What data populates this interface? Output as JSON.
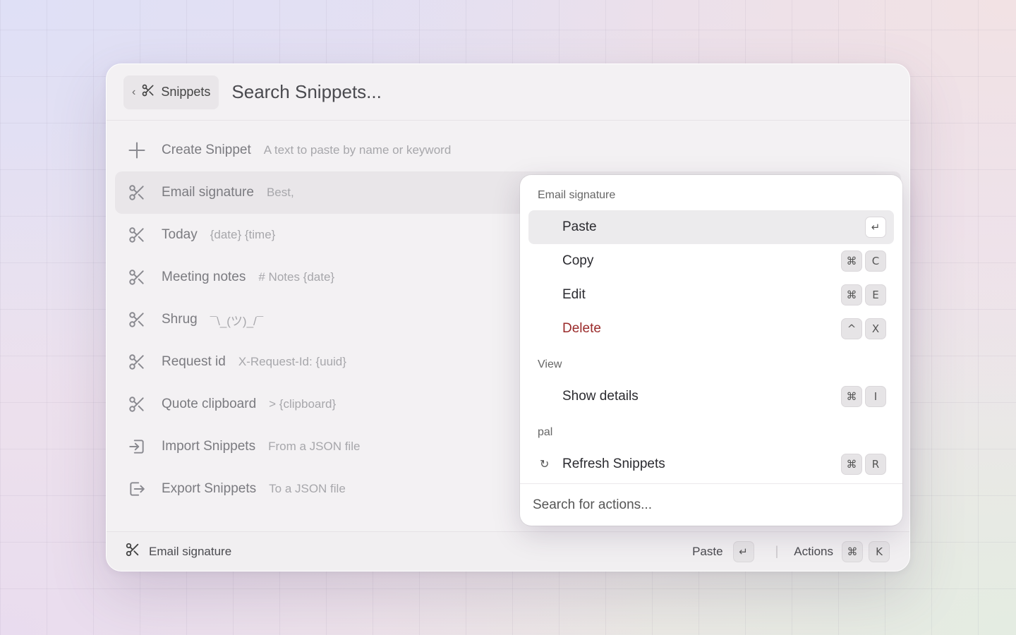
{
  "header": {
    "back_label": "Snippets",
    "search_placeholder": "Search Snippets..."
  },
  "list": [
    {
      "icon": "plus-icon",
      "title": "Create Snippet",
      "subtitle": "A text to paste by name or keyword"
    },
    {
      "icon": "scissors-icon",
      "title": "Email signature",
      "subtitle": "Best,",
      "selected": true
    },
    {
      "icon": "scissors-icon",
      "title": "Today",
      "subtitle": "{date} {time}"
    },
    {
      "icon": "scissors-icon",
      "title": "Meeting notes",
      "subtitle": "# Notes {date}"
    },
    {
      "icon": "scissors-icon",
      "title": "Shrug",
      "subtitle": "¯\\_(ツ)_/¯"
    },
    {
      "icon": "scissors-icon",
      "title": "Request id",
      "subtitle": "X-Request-Id: {uuid}"
    },
    {
      "icon": "scissors-icon",
      "title": "Quote clipboard",
      "subtitle": "> {clipboard}"
    },
    {
      "icon": "import-icon",
      "title": "Import Snippets",
      "subtitle": "From a JSON file"
    },
    {
      "icon": "export-icon",
      "title": "Export Snippets",
      "subtitle": "To a JSON file"
    }
  ],
  "menu": {
    "sections": [
      {
        "title": "Email signature",
        "items": [
          {
            "label": "Paste",
            "keys": [
              "↵"
            ],
            "active": true
          },
          {
            "label": "Copy",
            "keys": [
              "⌘",
              "C"
            ]
          },
          {
            "label": "Edit",
            "keys": [
              "⌘",
              "E"
            ]
          },
          {
            "label": "Delete",
            "keys": [
              "^",
              "X"
            ],
            "danger": true
          }
        ]
      },
      {
        "title": "View",
        "items": [
          {
            "label": "Show details",
            "keys": [
              "⌘",
              "I"
            ]
          }
        ]
      },
      {
        "title": "pal",
        "items": [
          {
            "label": "Refresh Snippets",
            "keys": [
              "⌘",
              "R"
            ],
            "lead": "↻"
          }
        ]
      }
    ],
    "search_placeholder": "Search for actions..."
  },
  "footer": {
    "selected_title": "Email signature",
    "primary_label": "Paste",
    "primary_key": "↵",
    "actions_label": "Actions",
    "actions_keys": [
      "⌘",
      "K"
    ]
  }
}
